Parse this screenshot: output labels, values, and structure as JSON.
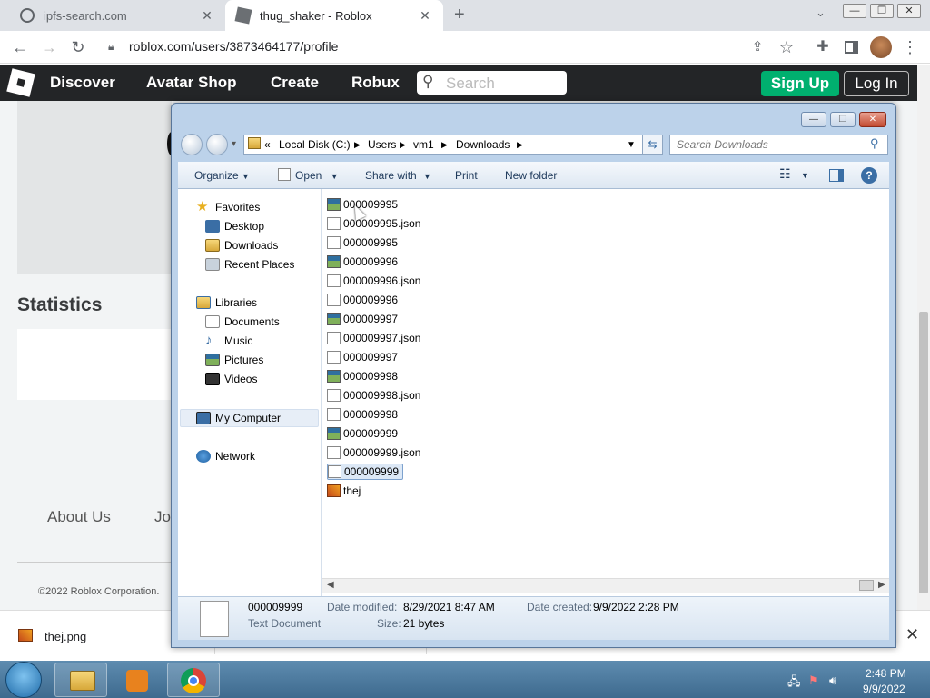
{
  "browser": {
    "tabs": [
      {
        "title": "ipfs-search.com",
        "active": false
      },
      {
        "title": "thug_shaker - Roblox",
        "active": true
      }
    ],
    "new_tab": "+",
    "url": "roblox.com/users/3873464177/profile"
  },
  "roblox": {
    "nav": [
      "Discover",
      "Avatar Shop",
      "Create",
      "Robux"
    ],
    "search_placeholder": "Search",
    "signup": "Sign Up",
    "login": "Log In",
    "statistics_title": "Statistics",
    "footer_about": "About Us",
    "footer_jobs": "Jo",
    "copyright": "©2022 Roblox Corporation."
  },
  "download_shelf": {
    "filename": "thej.png"
  },
  "explorer": {
    "breadcrumb": [
      "Local Disk (C:)",
      "Users",
      "vm1",
      "Downloads"
    ],
    "breadcrumb_prefix": "«",
    "search_placeholder": "Search Downloads",
    "commands": [
      "Organize",
      "Open",
      "Share with",
      "Print",
      "New folder"
    ],
    "favorites_label": "Favorites",
    "favorites": [
      "Desktop",
      "Downloads",
      "Recent Places"
    ],
    "libraries_label": "Libraries",
    "libraries": [
      "Documents",
      "Music",
      "Pictures",
      "Videos"
    ],
    "my_computer": "My Computer",
    "network": "Network",
    "files": [
      {
        "name": "000009995",
        "type": "image"
      },
      {
        "name": "000009995.json",
        "type": "doc"
      },
      {
        "name": "000009995",
        "type": "text"
      },
      {
        "name": "000009996",
        "type": "image"
      },
      {
        "name": "000009996.json",
        "type": "doc"
      },
      {
        "name": "000009996",
        "type": "text"
      },
      {
        "name": "000009997",
        "type": "image"
      },
      {
        "name": "000009997.json",
        "type": "doc"
      },
      {
        "name": "000009997",
        "type": "text"
      },
      {
        "name": "000009998",
        "type": "image"
      },
      {
        "name": "000009998.json",
        "type": "doc"
      },
      {
        "name": "000009998",
        "type": "text"
      },
      {
        "name": "000009999",
        "type": "image"
      },
      {
        "name": "000009999.json",
        "type": "doc"
      },
      {
        "name": "000009999",
        "type": "text",
        "selected": true
      },
      {
        "name": "thej",
        "type": "png"
      }
    ],
    "details": {
      "name": "000009999",
      "type": "Text Document",
      "modified_label": "Date modified:",
      "modified": "8/29/2021 8:47 AM",
      "created_label": "Date created:",
      "created": "9/9/2022 2:28 PM",
      "size_label": "Size:",
      "size": "21 bytes"
    }
  },
  "taskbar": {
    "time": "2:48 PM",
    "date": "9/9/2022"
  }
}
